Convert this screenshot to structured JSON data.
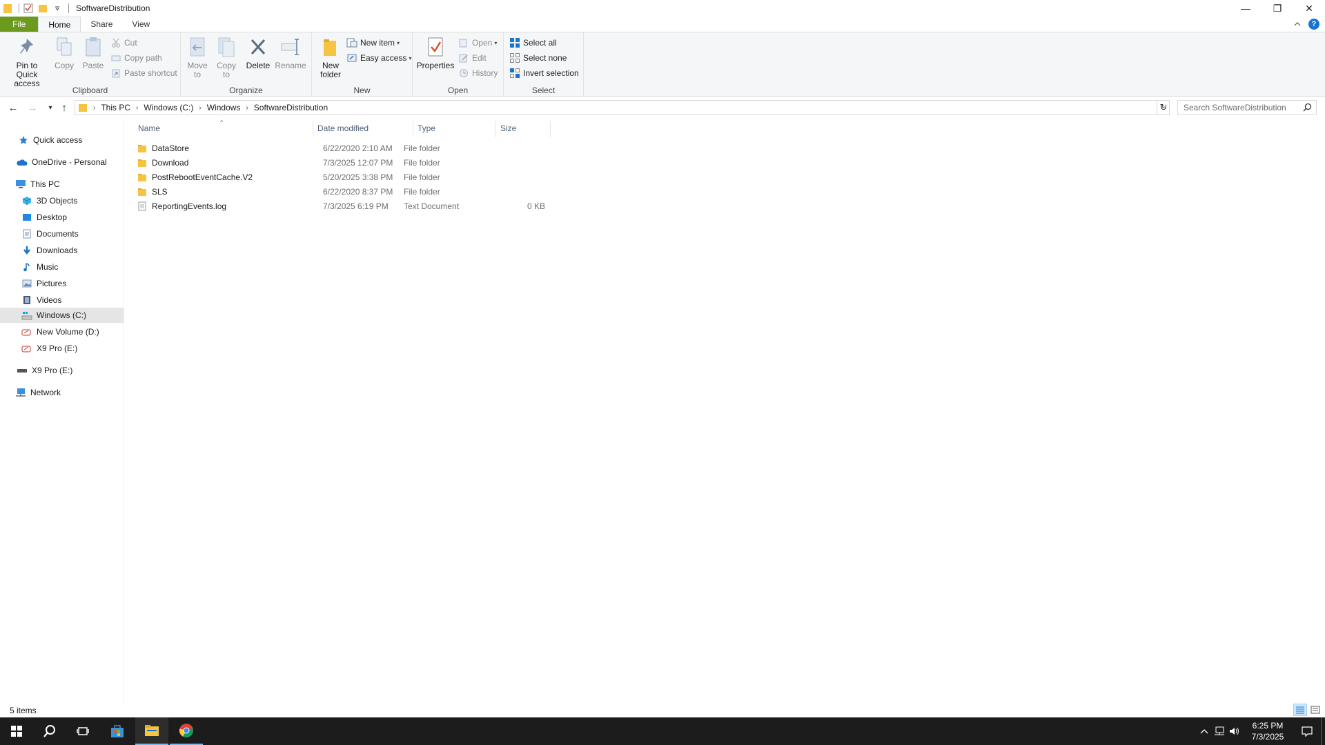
{
  "window": {
    "title": "SoftwareDistribution",
    "minimize": "—",
    "restore": "❐",
    "close": "✕"
  },
  "ribbon_tabs": [
    "File",
    "Home",
    "Share",
    "View"
  ],
  "ribbon": {
    "clipboard": {
      "label": "Clipboard",
      "pin": "Pin to Quick access",
      "copy": "Copy",
      "paste": "Paste",
      "cut": "Cut",
      "copy_path": "Copy path",
      "paste_shortcut": "Paste shortcut"
    },
    "organize": {
      "label": "Organize",
      "move_to": "Move to",
      "copy_to": "Copy to",
      "delete": "Delete",
      "rename": "Rename"
    },
    "new": {
      "label": "New",
      "new_folder": "New folder",
      "new_item": "New item",
      "easy_access": "Easy access"
    },
    "open": {
      "label": "Open",
      "properties": "Properties",
      "open": "Open",
      "edit": "Edit",
      "history": "History"
    },
    "select": {
      "label": "Select",
      "select_all": "Select all",
      "select_none": "Select none",
      "invert_selection": "Invert selection"
    }
  },
  "address": {
    "breadcrumbs": [
      "This PC",
      "Windows (C:)",
      "Windows",
      "SoftwareDistribution"
    ],
    "search_placeholder": "Search SoftwareDistribution"
  },
  "sidebar": {
    "items": [
      {
        "label": "Quick access",
        "icon": "star-icon"
      },
      {
        "label": "OneDrive - Personal",
        "icon": "cloud-icon"
      },
      {
        "label": "This PC",
        "icon": "computer-icon"
      },
      {
        "label": "3D Objects",
        "icon": "cube-icon"
      },
      {
        "label": "Desktop",
        "icon": "desktop-icon"
      },
      {
        "label": "Documents",
        "icon": "documents-icon"
      },
      {
        "label": "Downloads",
        "icon": "download-arrow-icon"
      },
      {
        "label": "Music",
        "icon": "music-note-icon"
      },
      {
        "label": "Pictures",
        "icon": "pictures-icon"
      },
      {
        "label": "Videos",
        "icon": "video-icon"
      },
      {
        "label": "Windows (C:)",
        "icon": "drive-c-icon"
      },
      {
        "label": "New Volume (D:)",
        "icon": "drive-icon"
      },
      {
        "label": "X9 Pro (E:)",
        "icon": "usb-drive-icon"
      },
      {
        "label": "X9 Pro (E:)",
        "icon": "usb-drive-icon"
      },
      {
        "label": "Network",
        "icon": "network-icon"
      }
    ],
    "selected": "Windows (C:)"
  },
  "columns": [
    "Name",
    "Date modified",
    "Type",
    "Size"
  ],
  "files": [
    {
      "name": "DataStore",
      "date": "6/22/2020 2:10 AM",
      "type": "File folder",
      "size": "",
      "icon": "folder-icon"
    },
    {
      "name": "Download",
      "date": "7/3/2025 12:07 PM",
      "type": "File folder",
      "size": "",
      "icon": "folder-icon"
    },
    {
      "name": "PostRebootEventCache.V2",
      "date": "5/20/2025 3:38 PM",
      "type": "File folder",
      "size": "",
      "icon": "folder-icon"
    },
    {
      "name": "SLS",
      "date": "6/22/2020 8:37 PM",
      "type": "File folder",
      "size": "",
      "icon": "folder-icon"
    },
    {
      "name": "ReportingEvents.log",
      "date": "7/3/2025 6:19 PM",
      "type": "Text Document",
      "size": "0 KB",
      "icon": "text-file-icon"
    }
  ],
  "status": {
    "items_count": "5 items"
  },
  "taskbar": {
    "time": "6:25 PM",
    "date": "7/3/2025"
  },
  "colors": {
    "file_tab": "#6b9a1f",
    "folder": "#f6c342",
    "accent": "#0078d7",
    "taskbar": "#1c1c1c"
  }
}
